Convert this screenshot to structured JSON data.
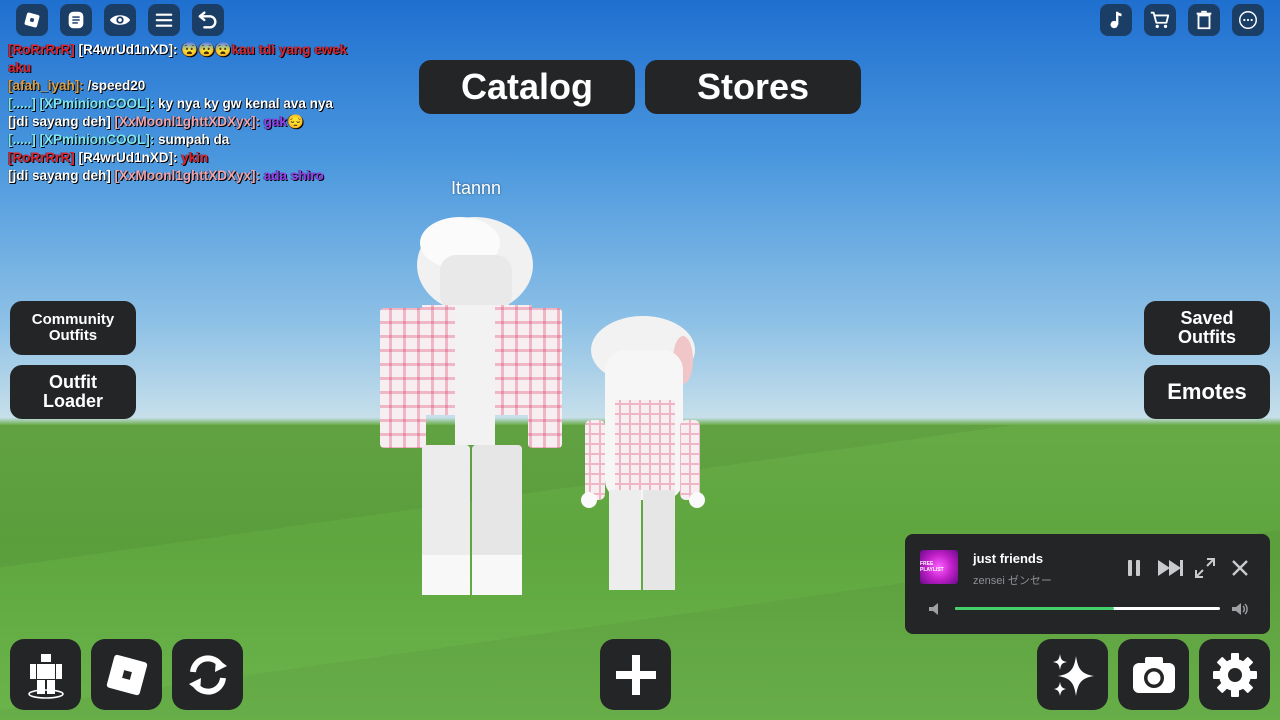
{
  "top_left_icons": [
    "roblox-menu-icon",
    "chat-icon",
    "eye-icon",
    "hamburger-icon",
    "undo-icon"
  ],
  "top_right_icons": [
    "music-note-icon",
    "cart-icon",
    "trash-icon",
    "more-icon"
  ],
  "chat": [
    {
      "tag": "[RoRrRrR]",
      "tag_color": "#e0242f",
      "user": "[R4wrUd1nXD]:",
      "user_color": "#ffffff",
      "text": "😨😨😨kau tdi yang ewek aku",
      "text_color": "#e0242f",
      "wrap": true
    },
    {
      "tag": "[afah_iyah]:",
      "tag_color": "#d9a04b",
      "user": "",
      "user_color": "#ffffff",
      "text": "/speed20",
      "text_color": "#ffffff"
    },
    {
      "tag": "[.....] [XPminionCOOL]:",
      "tag_color": "#7ee6ef",
      "user": "",
      "user_color": "#ffffff",
      "text": "ky nya ky gw kenal ava nya",
      "text_color": "#ffffff"
    },
    {
      "tag": "[jdi sayang deh]",
      "tag_color": "#ffffff",
      "user": "[XxMoonl1ghttXDXyx]:",
      "user_color": "#f0a3ad",
      "text": "gak😔",
      "text_color": "#9b3cf0"
    },
    {
      "tag": "[.....] [XPminionCOOL]:",
      "tag_color": "#7ee6ef",
      "user": "",
      "user_color": "#ffffff",
      "text": "sumpah da",
      "text_color": "#ffffff"
    },
    {
      "tag": "[RoRrRrR]",
      "tag_color": "#e0242f",
      "user": "[R4wrUd1nXD]:",
      "user_color": "#ffffff",
      "text": "ykin",
      "text_color": "#e0242f"
    },
    {
      "tag": "[jdi sayang deh]",
      "tag_color": "#ffffff",
      "user": "[XxMoonl1ghttXDXyx]:",
      "user_color": "#f0a3ad",
      "text": "ada shiro",
      "text_color": "#9b3cf0"
    }
  ],
  "tabs": {
    "catalog": "Catalog",
    "stores": "Stores"
  },
  "left_buttons": {
    "community_outfits": "Community Outfits",
    "outfit_loader": "Outfit Loader"
  },
  "right_buttons": {
    "saved_outfits": "Saved Outfits",
    "emotes": "Emotes"
  },
  "player_name": "Itannn",
  "music": {
    "title": "just friends",
    "artist": "zensei ゼンセー",
    "cover_text": "FREE PLAYLIST",
    "progress": 0.6
  },
  "bottom_left_icons": [
    "avatar-editor-icon",
    "roblox-logo-icon",
    "refresh-icon"
  ],
  "bottom_center_icon": "plus-icon",
  "bottom_right_icons": [
    "sparkle-icon",
    "camera-icon",
    "settings-icon"
  ],
  "colors": {
    "button_bg": "#232527",
    "progress": "#44d06a"
  }
}
